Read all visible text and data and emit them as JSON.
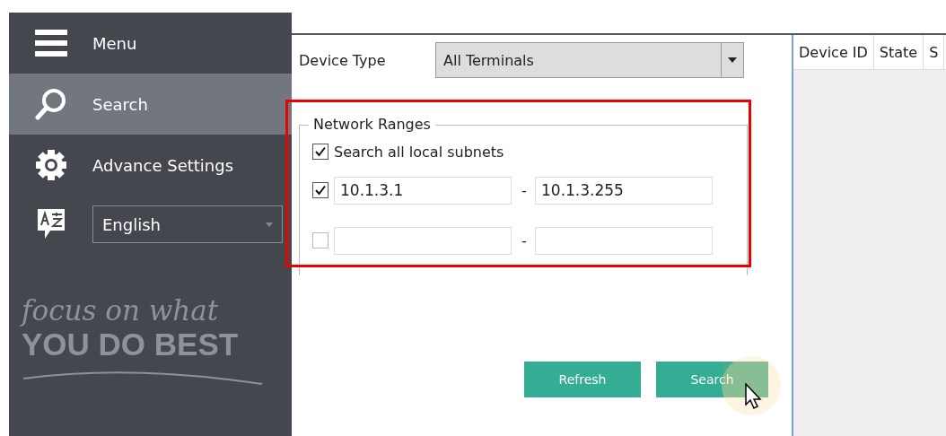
{
  "sidebar": {
    "items": [
      {
        "kind": "menu",
        "label": "Menu",
        "selected": false
      },
      {
        "kind": "search",
        "label": "Search",
        "selected": true
      },
      {
        "kind": "settings",
        "label": "Advance Settings",
        "selected": false
      }
    ],
    "language": {
      "value": "English"
    },
    "slogan": {
      "line1": "focus on what",
      "line2": "YOU DO BEST"
    }
  },
  "form": {
    "device_type": {
      "label": "Device Type",
      "value": "All Terminals"
    },
    "network_ranges": {
      "title": "Network Ranges",
      "search_all": {
        "label": "Search all local subnets",
        "checked": true
      },
      "ranges": [
        {
          "checked": true,
          "from": "10.1.3.1",
          "separator": "-",
          "to": "10.1.3.255"
        },
        {
          "checked": false,
          "separator": "-"
        }
      ]
    }
  },
  "buttons": [
    {
      "label": "Refresh",
      "hovered": false
    },
    {
      "label": "Search",
      "hovered": true
    }
  ],
  "table": {
    "columns": [
      "Device ID",
      "State",
      "S"
    ]
  }
}
